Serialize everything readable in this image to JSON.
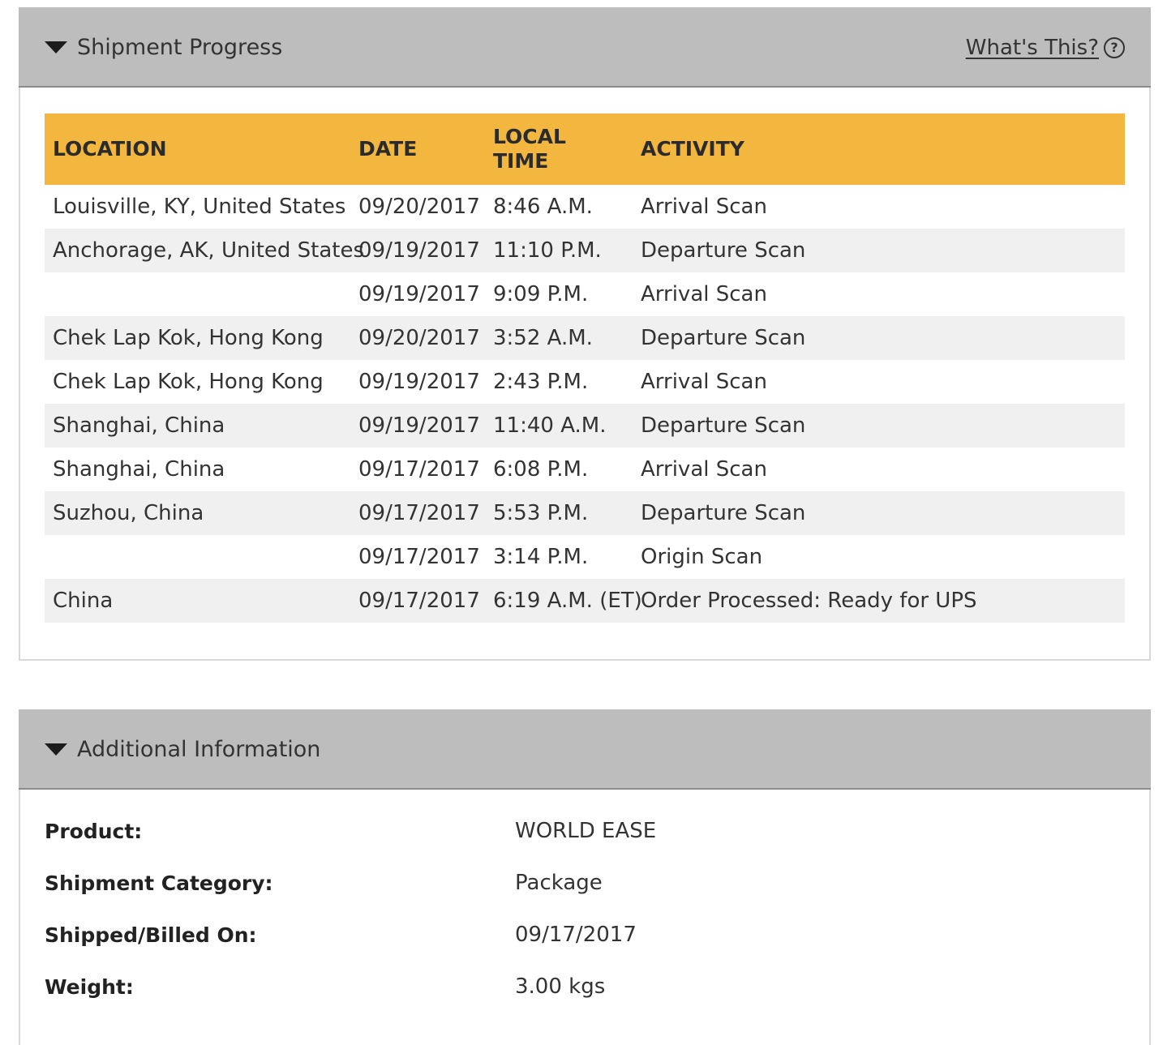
{
  "shipment_progress": {
    "title": "Shipment Progress",
    "whats_this": "What's This?",
    "help_icon": "?",
    "columns": {
      "location": "LOCATION",
      "date": "DATE",
      "local_time_line1": "LOCAL",
      "local_time_line2": "TIME",
      "activity": "ACTIVITY"
    },
    "rows": [
      {
        "location": "Louisville,  KY,  United States",
        "date": "09/20/2017",
        "time": "8:46 A.M.",
        "activity": "Arrival Scan"
      },
      {
        "location": "Anchorage,  AK,  United States",
        "date": "09/19/2017",
        "time": "11:10 P.M.",
        "activity": "Departure Scan"
      },
      {
        "location": "",
        "date": "09/19/2017",
        "time": "9:09 P.M.",
        "activity": "Arrival Scan"
      },
      {
        "location": "Chek Lap Kok,  Hong Kong",
        "date": "09/20/2017",
        "time": "3:52 A.M.",
        "activity": "Departure Scan"
      },
      {
        "location": "Chek Lap Kok,  Hong Kong",
        "date": "09/19/2017",
        "time": "2:43 P.M.",
        "activity": "Arrival Scan"
      },
      {
        "location": "Shanghai,  China",
        "date": "09/19/2017",
        "time": "11:40 A.M.",
        "activity": "Departure Scan"
      },
      {
        "location": "Shanghai,  China",
        "date": "09/17/2017",
        "time": "6:08 P.M.",
        "activity": "Arrival Scan"
      },
      {
        "location": "Suzhou,  China",
        "date": "09/17/2017",
        "time": "5:53 P.M.",
        "activity": "Departure Scan"
      },
      {
        "location": "",
        "date": "09/17/2017",
        "time": "3:14 P.M.",
        "activity": "Origin Scan"
      },
      {
        "location": "China",
        "date": "09/17/2017",
        "time": "6:19 A.M. (ET)",
        "activity": "Order Processed: Ready for UPS"
      }
    ]
  },
  "additional_information": {
    "title": "Additional Information",
    "fields": [
      {
        "label": "Product:",
        "value": "WORLD EASE"
      },
      {
        "label": "Shipment Category:",
        "value": "Package"
      },
      {
        "label": "Shipped/Billed On:",
        "value": "09/17/2017"
      },
      {
        "label": "Weight:",
        "value": "3.00 kgs"
      }
    ]
  },
  "colors": {
    "header_bar": "#bdbdbd",
    "table_header": "#f3b73f",
    "stripe": "#f0f0f0"
  },
  "icons": {
    "collapse": "caret-down-icon",
    "help": "question-circle-icon"
  }
}
